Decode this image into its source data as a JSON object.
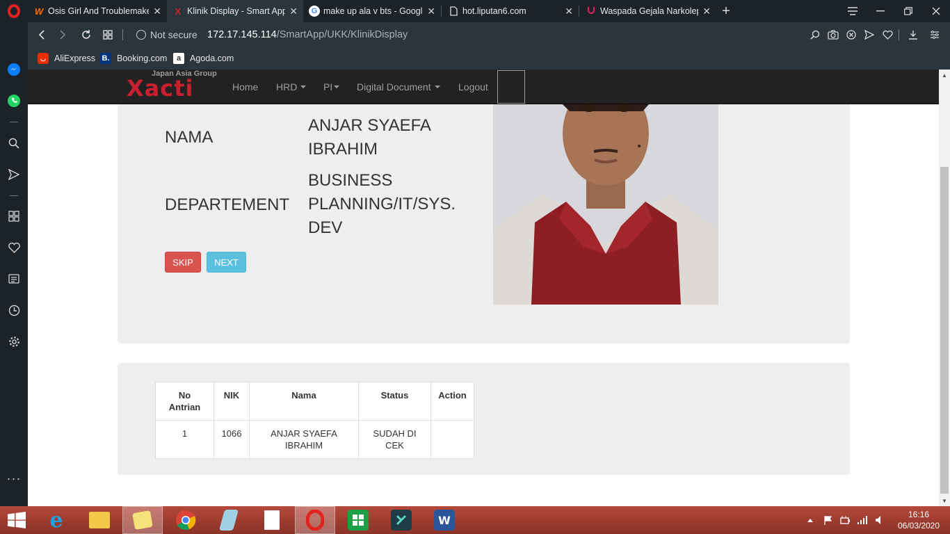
{
  "browser": {
    "tabs": [
      {
        "title": "Osis Girl And Troublemaker",
        "favicon": "W",
        "favicon_color": "#ff6a00"
      },
      {
        "title": "Klinik Display - Smart App",
        "favicon": "X",
        "favicon_color": "#c8202f"
      },
      {
        "title": "make up ala v bts - Google",
        "favicon": "G",
        "favicon_color": "#4285f4"
      },
      {
        "title": "hot.liputan6.com",
        "favicon": "page",
        "favicon_color": "#dddddd"
      },
      {
        "title": "Waspada Gejala Narkolepsi",
        "favicon": "stethoscope",
        "favicon_color": "#e0245e"
      }
    ],
    "security_label": "Not secure",
    "url_host": "172.17.145.114",
    "url_path": "/SmartApp/UKK/KlinikDisplay",
    "bookmarks": [
      {
        "label": "AliExpress",
        "icon": "aliexpress-icon",
        "color": "#e62e04"
      },
      {
        "label": "Booking.com",
        "icon": "booking-icon",
        "color": "#003580"
      },
      {
        "label": "Agoda.com",
        "icon": "agoda-icon",
        "color": "#ffffff"
      }
    ]
  },
  "site": {
    "brand_sub": "Japan Asia Group",
    "brand_name": "Xacti",
    "brand_color": "#c8202f",
    "nav": {
      "home": "Home",
      "hrd": "HRD",
      "pi": "PI",
      "digital_document": "Digital Document",
      "logout": "Logout"
    }
  },
  "patient": {
    "name_label": "NAMA",
    "name_value": "ANJAR SYAEFA IBRAHIM",
    "dept_label": "DEPARTEMENT",
    "dept_value": "BUSINESS PLANNING/IT/SYS. DEV",
    "skip_label": "SKIP",
    "next_label": "NEXT"
  },
  "queue": {
    "headers": [
      "No Antrian",
      "NIK",
      "Nama",
      "Status",
      "Action"
    ],
    "rows": [
      [
        "1",
        "1066",
        "ANJAR SYAEFA IBRAHIM",
        "SUDAH DI CEK",
        ""
      ]
    ]
  },
  "taskbar": {
    "time": "16:16",
    "date": "06/03/2020"
  }
}
